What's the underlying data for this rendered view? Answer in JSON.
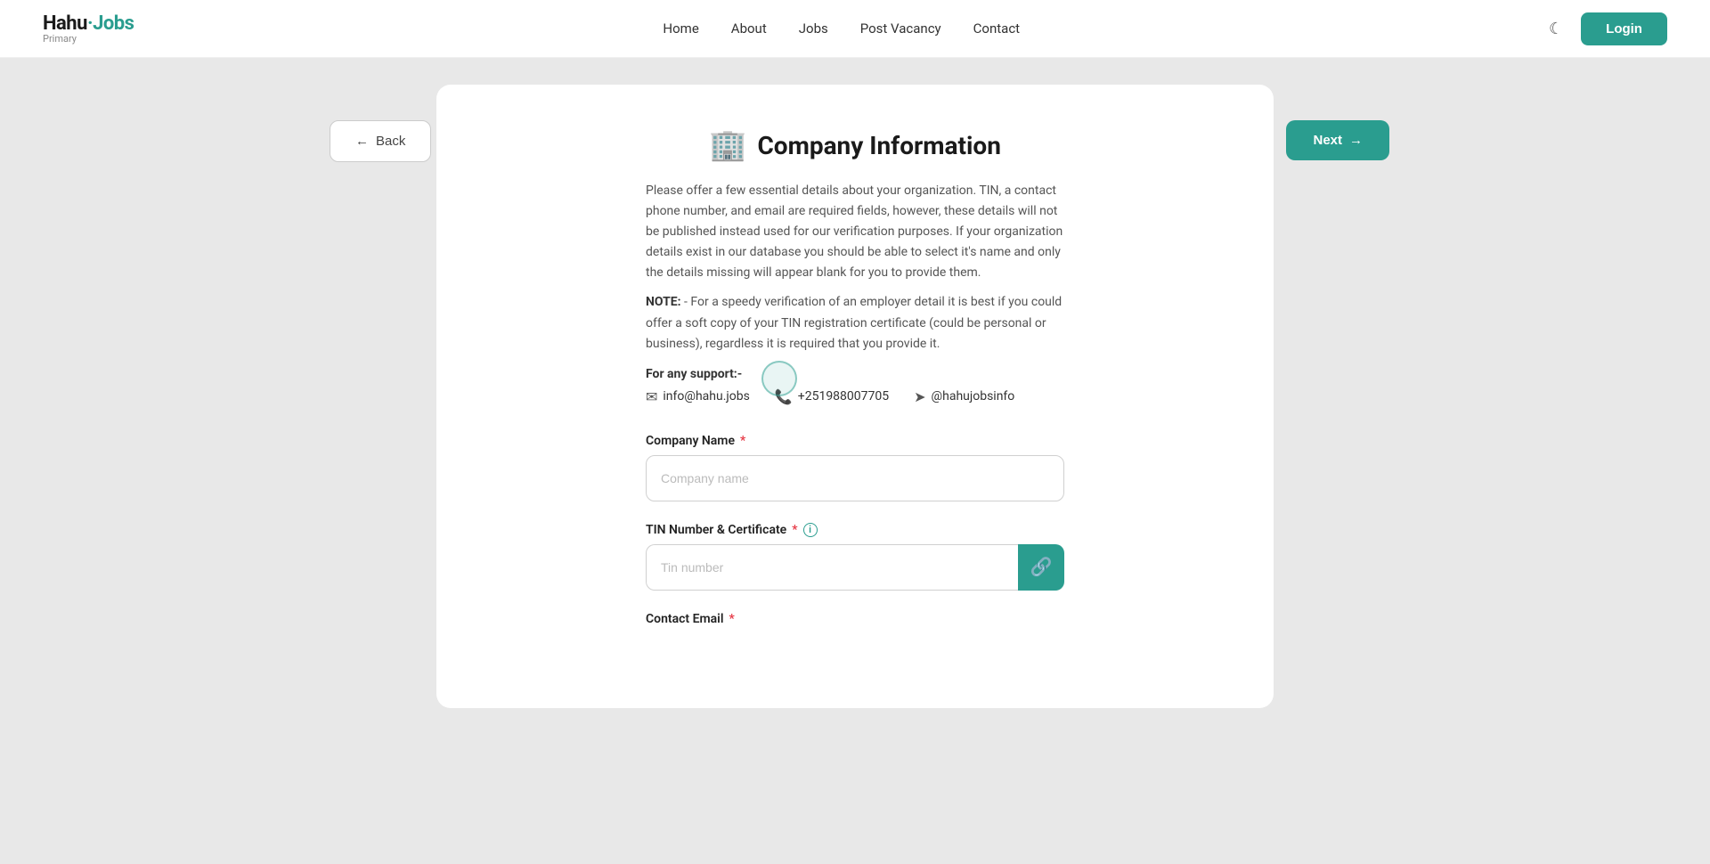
{
  "navbar": {
    "logo_text": "Hahu Jobs",
    "logo_sub": "Primary",
    "nav_links": [
      {
        "label": "Home",
        "id": "home"
      },
      {
        "label": "About",
        "id": "about"
      },
      {
        "label": "Jobs",
        "id": "jobs"
      },
      {
        "label": "Post Vacancy",
        "id": "post-vacancy"
      },
      {
        "label": "Contact",
        "id": "contact"
      }
    ],
    "login_label": "Login",
    "dark_mode_icon": "☾"
  },
  "page": {
    "back_label": "Back",
    "next_label": "Next",
    "title": "Company Information",
    "description": "Please offer a few essential details about your organization. TIN, a contact phone number, and email are required fields, however, these details will not be published instead used for our verification purposes. If your organization details exist in our database you should be able to select it's name and only the details missing will appear blank for you to provide them.",
    "note_prefix": "NOTE:",
    "note_text": " - For a speedy verification of an employer detail it is best if you could offer a soft copy of your TIN registration certificate (could be personal or business), regardless it is required that you provide it.",
    "support_label": "For any support:-",
    "contact_email": "info@hahu.jobs",
    "contact_phone": "+251988007705",
    "contact_telegram": "@hahujobsinfo"
  },
  "form": {
    "company_name_label": "Company Name",
    "company_name_placeholder": "Company name",
    "tin_label": "TIN Number & Certificate",
    "tin_placeholder": "Tin number",
    "contact_email_label": "Contact Email"
  }
}
